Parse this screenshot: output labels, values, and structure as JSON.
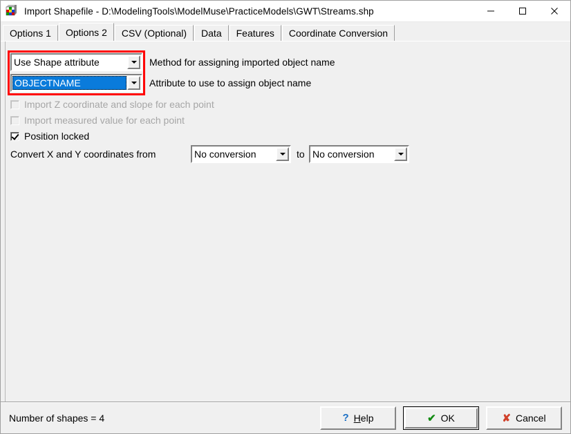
{
  "window": {
    "title": "Import Shapefile - D:\\ModelingTools\\ModelMuse\\PracticeModels\\GWT\\Streams.shp",
    "app_icon": "modelmuse-grid-icon",
    "minimize_label": "Minimize",
    "maximize_label": "Maximize",
    "close_label": "Close"
  },
  "tabs": [
    {
      "label": "Options 1",
      "active": false
    },
    {
      "label": "Options 2",
      "active": true
    },
    {
      "label": "CSV (Optional)",
      "active": false
    },
    {
      "label": "Data",
      "active": false
    },
    {
      "label": "Features",
      "active": false
    },
    {
      "label": "Coordinate Conversion",
      "active": false
    }
  ],
  "options2": {
    "method_combo": {
      "value": "Use Shape attribute",
      "label": "Method for assigning imported object name"
    },
    "attribute_combo": {
      "value": "OBJECTNAME",
      "label": "Attribute to use to assign object name",
      "selected": true
    },
    "checkboxes": [
      {
        "label": "Import Z coordinate and slope for each point",
        "checked": false,
        "disabled": true
      },
      {
        "label": "Import measured value for each point",
        "checked": false,
        "disabled": true
      },
      {
        "label": "Position locked",
        "checked": true,
        "disabled": false
      }
    ],
    "convert_label": "Convert X and Y coordinates from",
    "convert_from": "No conversion",
    "convert_to_label": "to",
    "convert_to": "No conversion"
  },
  "footer": {
    "status": "Number of shapes = 4",
    "help_mnemonic": "H",
    "help_label": "elp",
    "ok_label": "OK",
    "cancel_label": "Cancel"
  },
  "colors": {
    "annotation_red": "#ff0000",
    "selection_blue": "#0a7bdb",
    "help_blue": "#1a6fc4",
    "ok_green": "#128a12",
    "cancel_red": "#d0402a",
    "window_face": "#f0f0f0"
  }
}
